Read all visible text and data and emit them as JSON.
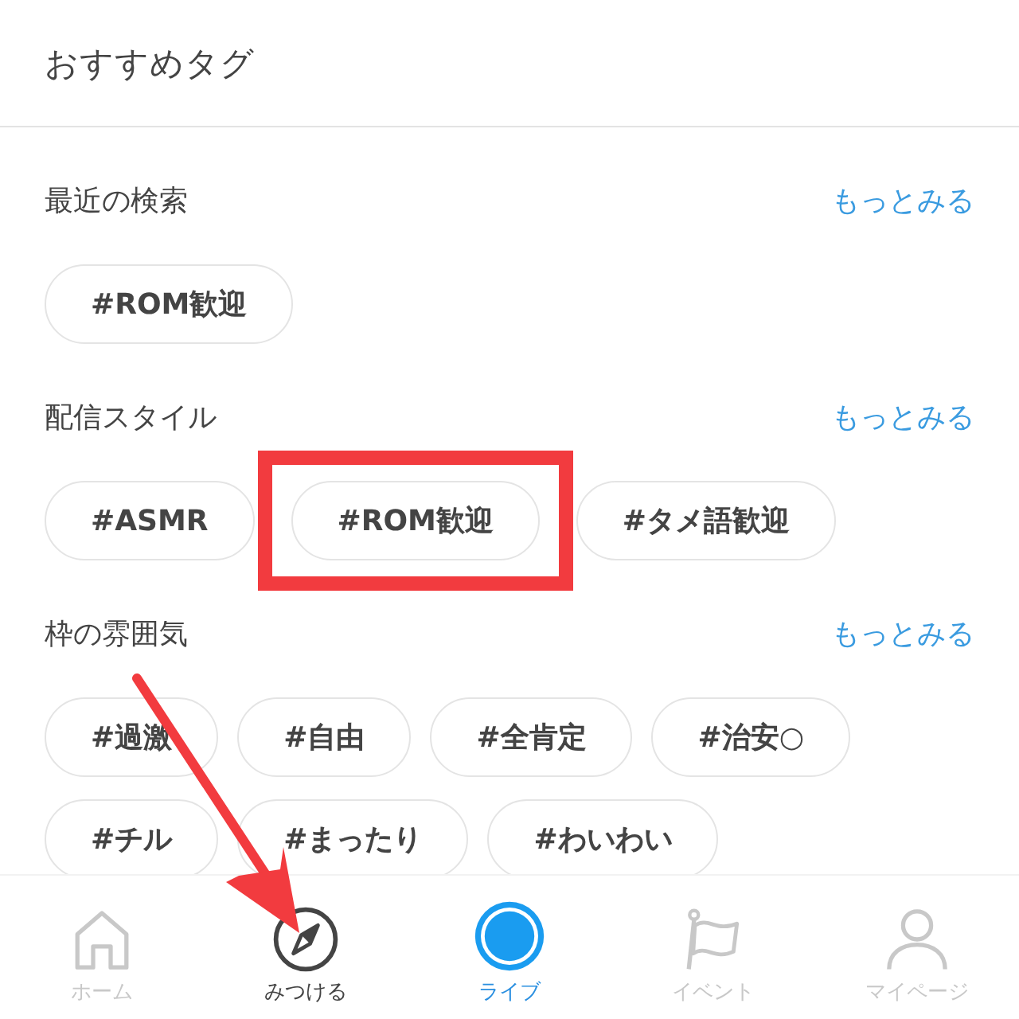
{
  "header": {
    "title": "おすすめタグ"
  },
  "sections": [
    {
      "title": "最近の検索",
      "more_link": "もっとみる",
      "tags": [
        {
          "label": "#ROM歓迎",
          "highlighted": false
        }
      ]
    },
    {
      "title": "配信スタイル",
      "more_link": "もっとみる",
      "tags": [
        {
          "label": "#ASMR",
          "highlighted": false
        },
        {
          "label": "#ROM歓迎",
          "highlighted": true
        },
        {
          "label": "#タメ語歓迎",
          "highlighted": false
        }
      ]
    },
    {
      "title": "枠の雰囲気",
      "more_link": "もっとみる",
      "tags": [
        {
          "label": "#過激",
          "highlighted": false
        },
        {
          "label": "#自由",
          "highlighted": false
        },
        {
          "label": "#全肯定",
          "highlighted": false
        },
        {
          "label": "#治安○",
          "highlighted": false
        },
        {
          "label": "#チル",
          "highlighted": false
        },
        {
          "label": "#まったり",
          "highlighted": false
        },
        {
          "label": "#わいわい",
          "highlighted": false
        }
      ]
    }
  ],
  "tab_bar": [
    {
      "label": "ホーム",
      "kind": "home",
      "selected": false
    },
    {
      "label": "みつける",
      "kind": "discover",
      "selected": true
    },
    {
      "label": "ライブ",
      "kind": "live",
      "selected": false
    },
    {
      "label": "イベント",
      "kind": "event",
      "selected": false
    },
    {
      "label": "マイページ",
      "kind": "mypage",
      "selected": false
    }
  ]
}
